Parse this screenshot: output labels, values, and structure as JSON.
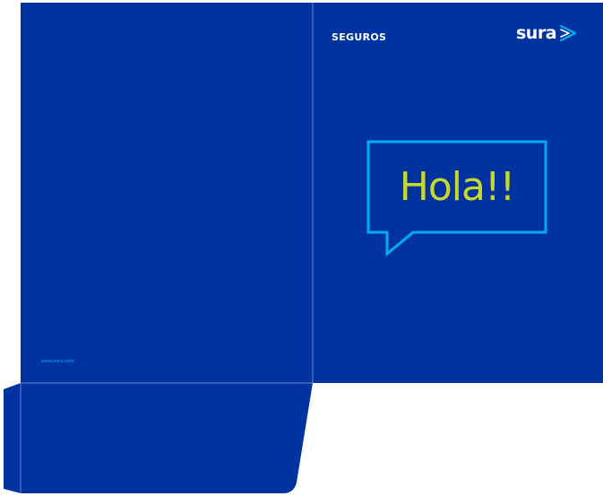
{
  "cover": {
    "brand_label": "SEGUROS",
    "logo_text": "sura",
    "speech_text": "Hola!!"
  },
  "back_panel": {
    "web_url": "www.sura.com"
  },
  "colors": {
    "background_blue": "#0033a0",
    "accent_cyan": "#00aeef",
    "greeting_lime": "#c7d82d",
    "fold_line": "#8fa5dc"
  },
  "icons": {
    "logo_mark": "sura-wing-icon",
    "speech_bubble": "speech-bubble-icon"
  }
}
